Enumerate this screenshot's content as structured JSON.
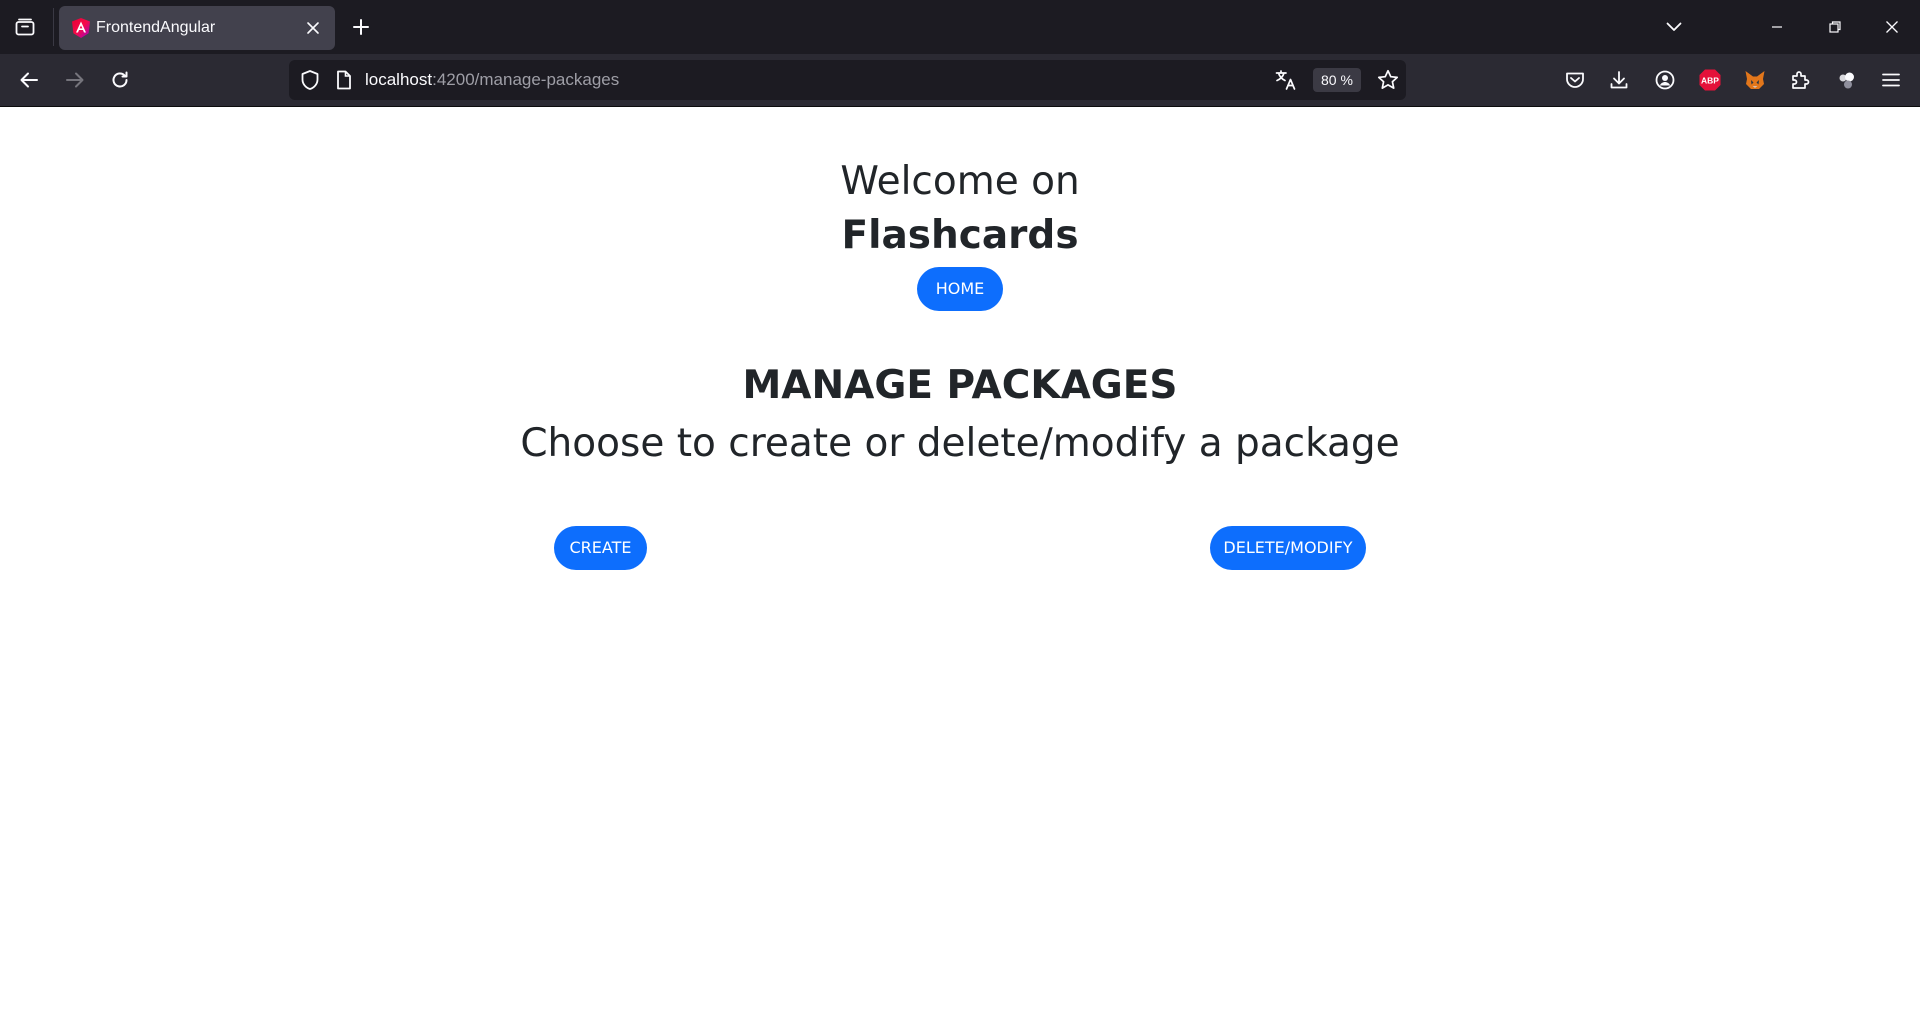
{
  "browser": {
    "tab": {
      "title": "FrontendAngular"
    },
    "url": {
      "host": "localhost",
      "rest": ":4200/manage-packages"
    },
    "zoom": "80 %",
    "colors": {
      "tabbar": "#1c1b22",
      "navbar": "#2b2a33",
      "accent": "#0d6efd"
    },
    "icons": {
      "tab_list": "tab-list-icon",
      "favicon": "angular-icon",
      "close": "close-icon",
      "new_tab": "plus-icon",
      "overflow": "chevron-down-icon",
      "back": "back-arrow-icon",
      "forward": "forward-arrow-icon",
      "reload": "reload-icon",
      "shield": "shield-icon",
      "page": "page-icon",
      "translate": "translate-icon",
      "bookmark": "star-icon",
      "pocket": "pocket-icon",
      "downloads": "download-icon",
      "account": "account-icon",
      "adblock": "abp-icon",
      "metamask": "fox-icon",
      "extensions": "puzzle-icon",
      "extension2": "extension-icon",
      "menu": "hamburger-icon"
    },
    "adblock_label": "ABP"
  },
  "header": {
    "welcome": "Welcome on",
    "brand": "Flashcards",
    "home_button": "HOME"
  },
  "main": {
    "title": "MANAGE PACKAGES",
    "subtitle": "Choose to create or delete/modify a package",
    "create_button": "CREATE",
    "delete_modify_button": "DELETE/MODIFY"
  }
}
